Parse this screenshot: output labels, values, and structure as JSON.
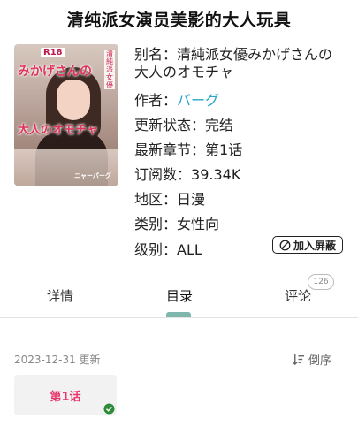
{
  "title": "清纯派女演员美影的大人玩具",
  "cover": {
    "badge": "R18",
    "vertical_text": "清純派女優",
    "big_text_1": "みかげさんの",
    "big_text_2": "大人のオモチャ",
    "author_mark": "ニャーパーグ"
  },
  "info": {
    "alias_label": "别名：",
    "alias_value": "清純派女優みかげさんの大人のオモチャ",
    "author_label": "作者：",
    "author_value": "バーグ",
    "status_label": "更新状态：",
    "status_value": "完结",
    "latest_label": "最新章节：",
    "latest_value": "第1话",
    "subs_label": "订阅数：",
    "subs_value": "39.34K",
    "region_label": "地区：",
    "region_value": "日漫",
    "category_label": "类别：",
    "category_value": "女性向",
    "rating_label": "级别：",
    "rating_value": "ALL"
  },
  "block_button": "加入屏蔽",
  "tabs": [
    {
      "label": "详情"
    },
    {
      "label": "目录",
      "active": true
    },
    {
      "label": "评论"
    }
  ],
  "comment_count": "126",
  "update_text": "2023-12-31 更新",
  "sort_label": "倒序",
  "chapters": [
    {
      "label": "第1话",
      "read": true
    }
  ],
  "colors": {
    "accent_link": "#2aa7c9",
    "chapter_text": "#e8356c",
    "tab_indicator": "#7fb7ad",
    "check_green": "#2e8b3a"
  }
}
